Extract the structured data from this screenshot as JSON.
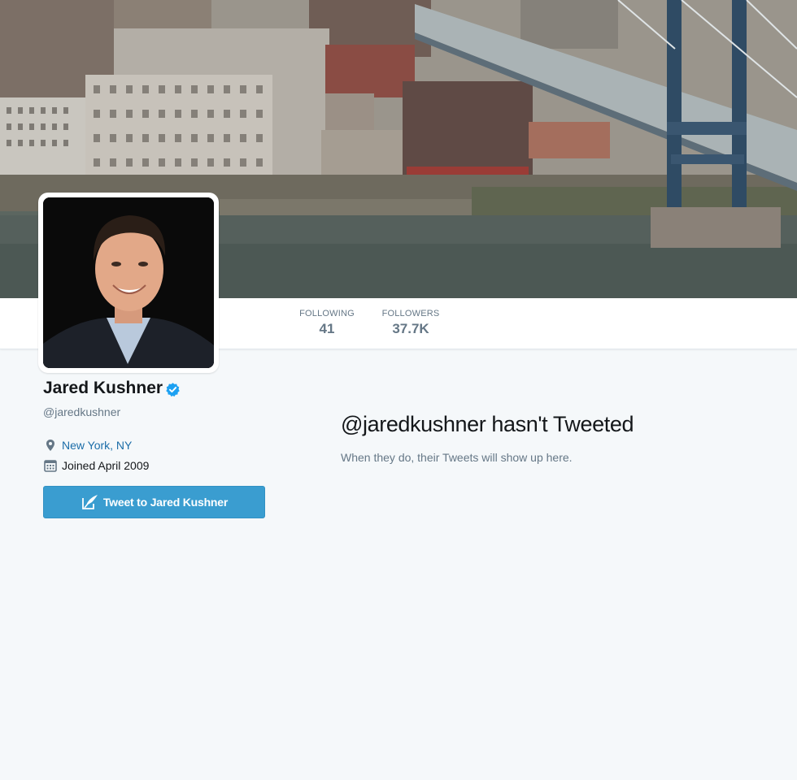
{
  "profile": {
    "full_name": "Jared Kushner",
    "handle": "@jaredkushner",
    "verified": true,
    "location": "New York, NY",
    "joined": "Joined April 2009"
  },
  "stats": {
    "following_label": "FOLLOWING",
    "following_value": "41",
    "followers_label": "FOLLOWERS",
    "followers_value": "37.7K"
  },
  "actions": {
    "tweet_to_label": "Tweet to Jared Kushner"
  },
  "empty_state": {
    "handle": "@jaredkushner",
    "title_rest": " hasn't Tweeted",
    "subtitle": "When they do, their Tweets will show up here."
  },
  "icons": {
    "verified": "verified-badge-icon",
    "location": "map-pin-icon",
    "calendar": "calendar-icon",
    "compose": "compose-tweet-icon"
  },
  "colors": {
    "accent": "#1da1f2",
    "link": "#1b6da8",
    "button": "#3a9dd0",
    "muted": "#657786",
    "background": "#f5f8fa"
  }
}
